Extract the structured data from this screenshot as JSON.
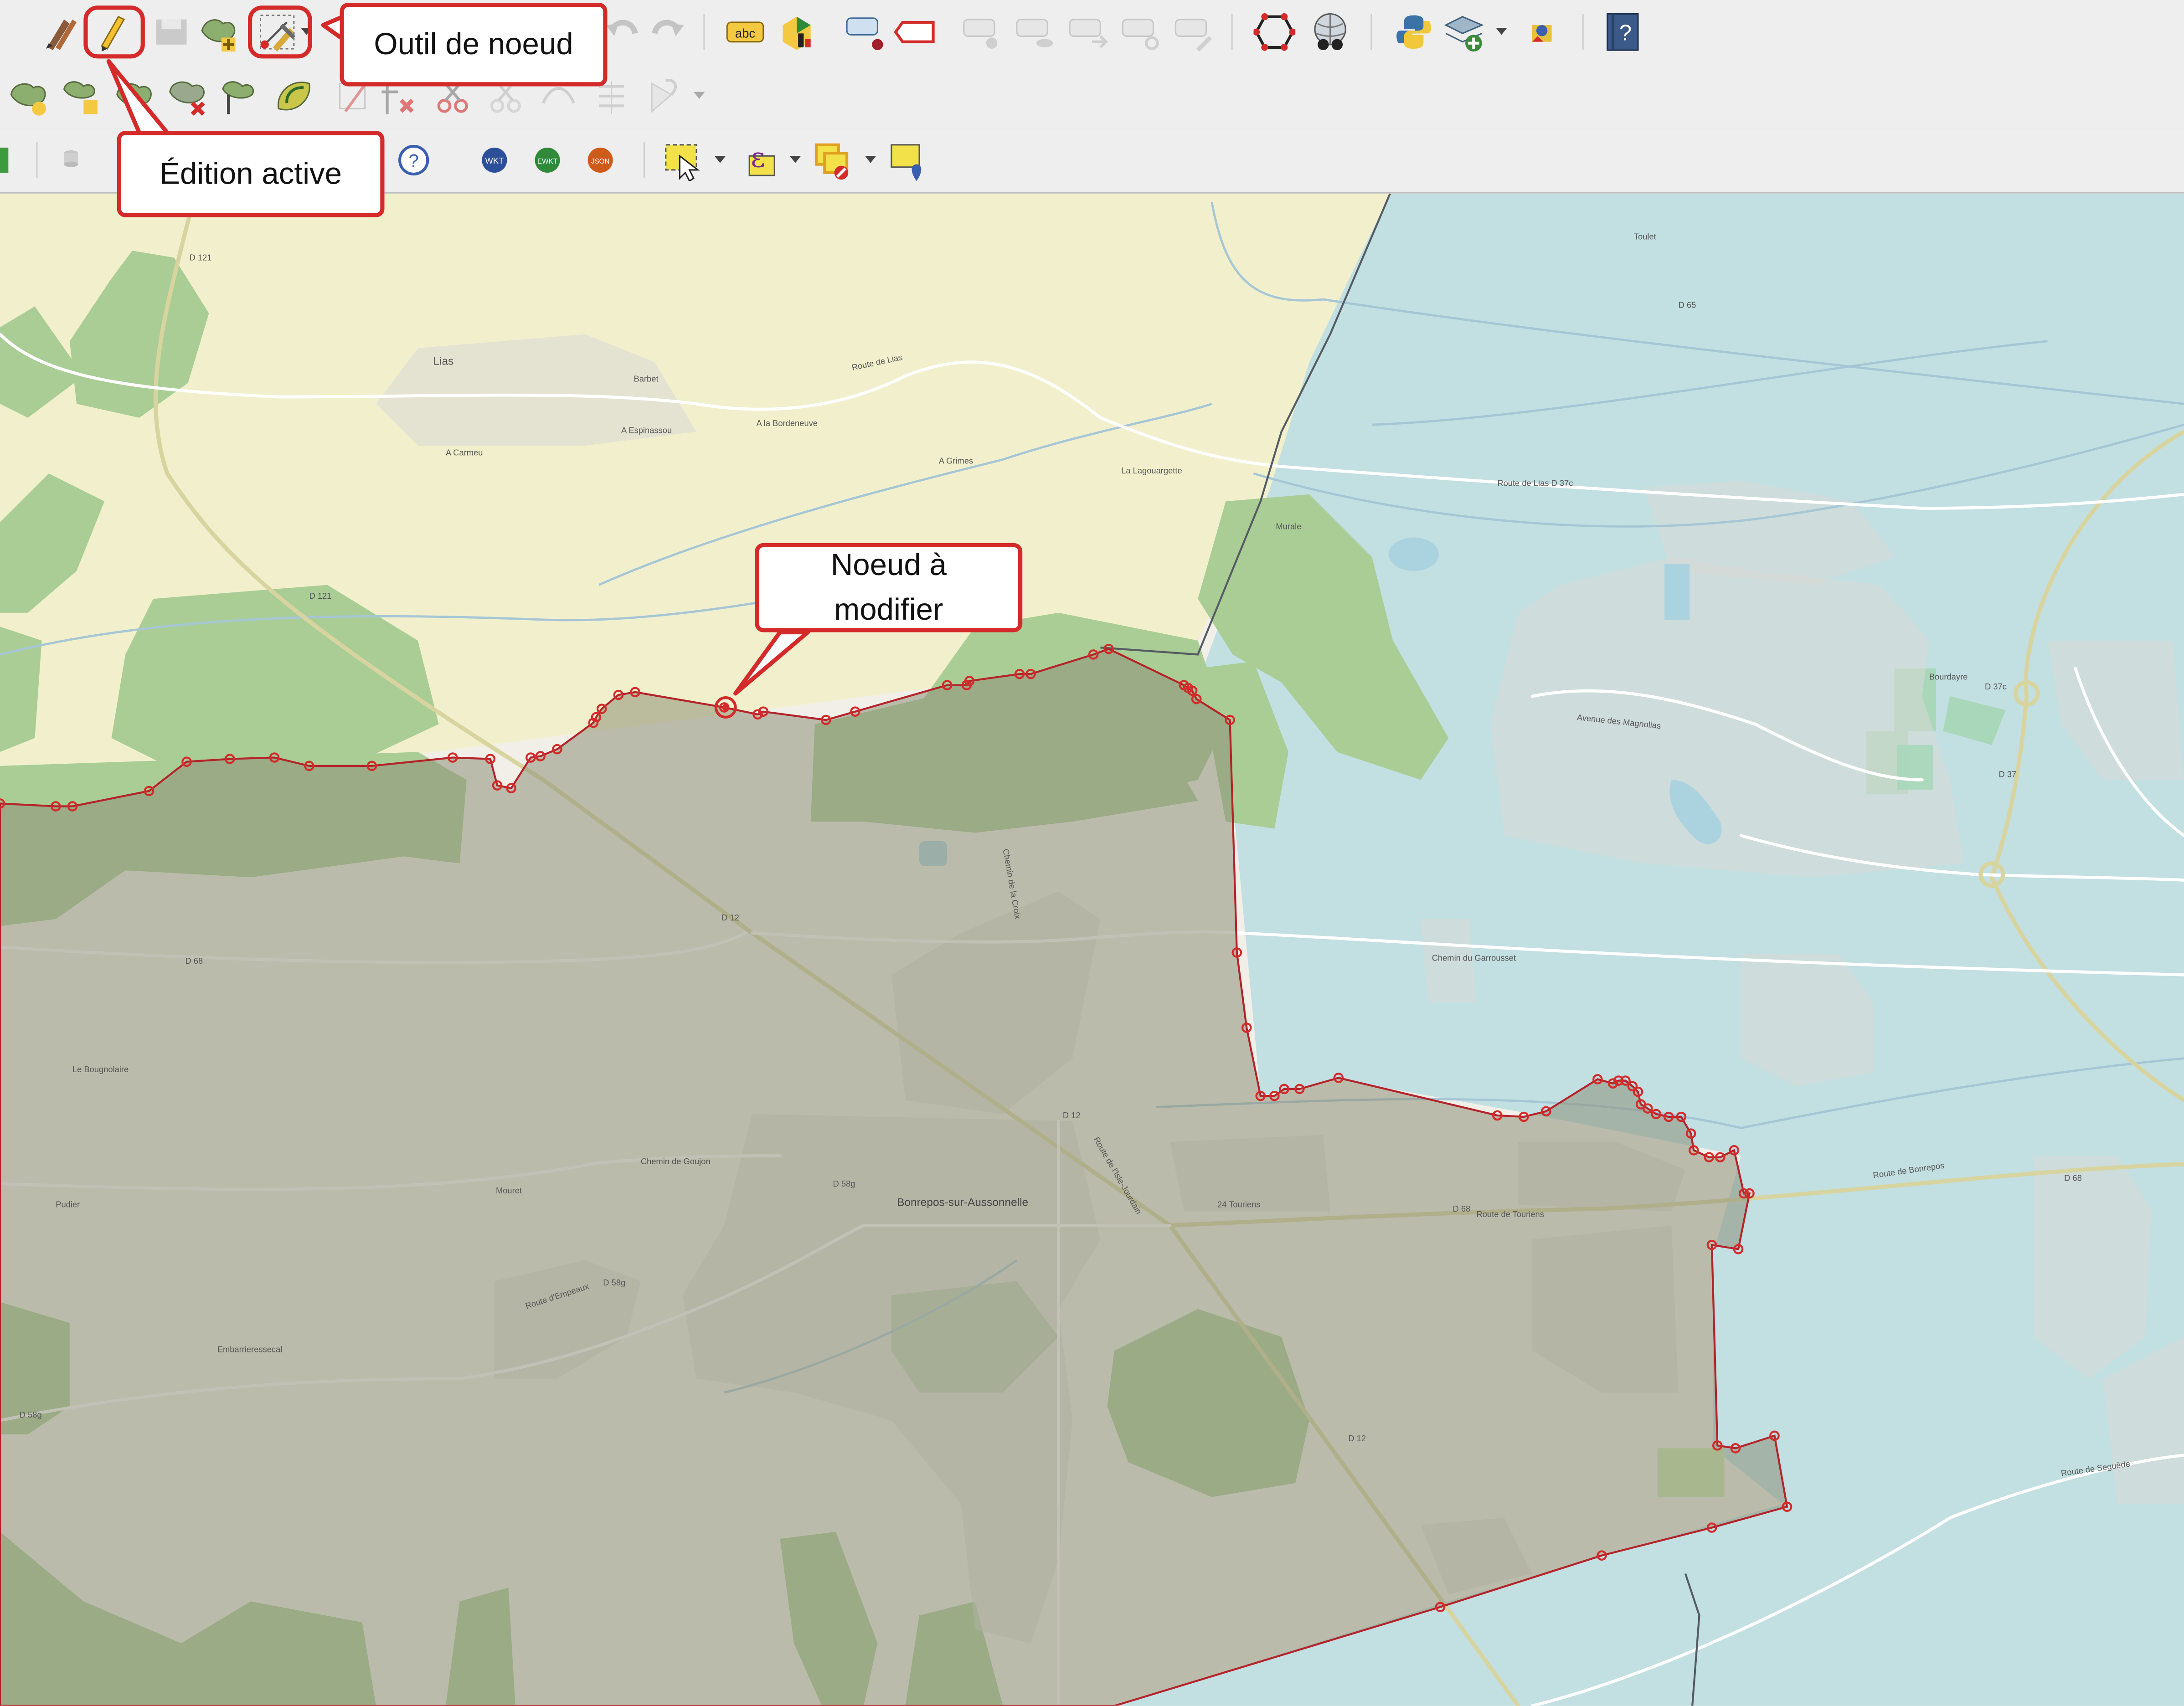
{
  "toolbar": {
    "annotated_tools": {
      "pencil": "pencil-icon",
      "node_tool": "node-tool-icon"
    },
    "format_buttons": [
      "WKT",
      "EWKT",
      "JSON"
    ],
    "label_text": "abc",
    "help_glyph": "?"
  },
  "callouts": {
    "node_tool": "Outil de noeud",
    "edition_active": "Édition active",
    "node_to_modify": "Noeud à modifier"
  },
  "map": {
    "colors": {
      "polygon_fill": "#8e9078",
      "polygon_stroke": "#b4232a",
      "vertex": "#d42a2a",
      "left_region": "#f2f0cc",
      "right_region": "#c2dfe2",
      "forest": "#a9cd95",
      "callout_border": "#d42a2a"
    },
    "labels": {
      "lias": "Lias",
      "bonrepos": "Bonrepos-sur-Aussonnelle",
      "roads": [
        "D 121",
        "D 12",
        "D 68",
        "D 58g",
        "D 65",
        "D 37",
        "D 37c",
        "D 68",
        "D 12"
      ],
      "streets": [
        "Route de Lias",
        "Route de Lias D 37c",
        "Route de Touriens",
        "Route de Bonrepos",
        "Route de Seguède",
        "Route d'Empeaux",
        "Chemin de Goujon",
        "Avenue des Magnolias",
        "Chemin du Garrousset",
        "Route de l'Isle-Jourdain",
        "Chemin de la Croix"
      ],
      "places": [
        "A Carmeu",
        "A Espinassou",
        "A la Bordeneuve",
        "A Grimes",
        "La Lagouargette",
        "Barbet",
        "Bourdayre",
        "Mouret",
        "Pudier",
        "Embarrieressecal",
        "24 Touriens",
        "Le Bougnolaire",
        "Murale",
        "Toulet"
      ]
    }
  }
}
